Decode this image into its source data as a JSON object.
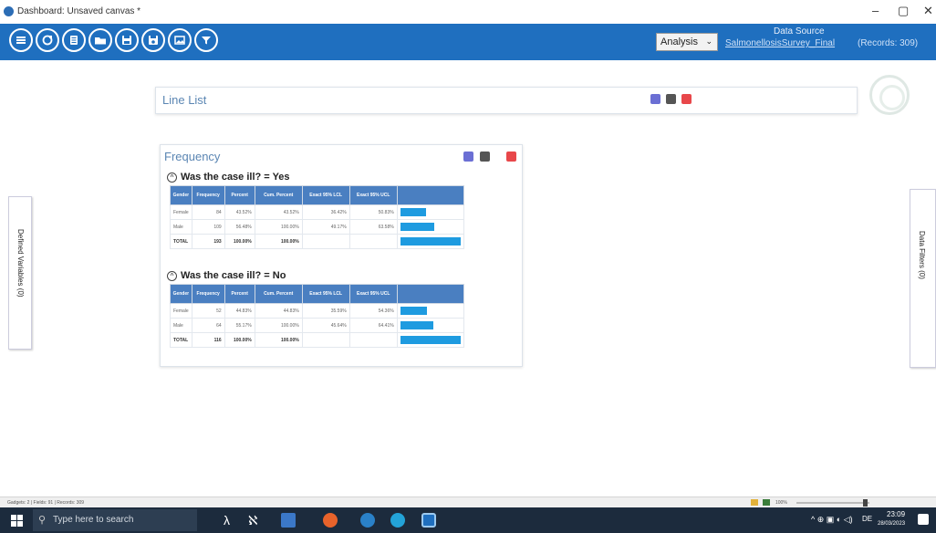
{
  "window": {
    "title": "Dashboard: Unsaved canvas *",
    "minimize": "–",
    "maximize": "▢",
    "close": "✕"
  },
  "toolbar": {
    "buttons": [
      "menu-icon",
      "refresh-icon",
      "list-icon",
      "folder-icon",
      "save-icon",
      "save-as-icon",
      "image-icon",
      "filter-icon"
    ],
    "analysis_label": "Analysis",
    "data_source_title": "Data Source",
    "data_source_name": "SalmonellosisSurvey_Final",
    "records": "(Records: 309)"
  },
  "side_tabs": {
    "left": "Defined Variables (0)",
    "right": "Data Filters (0)"
  },
  "line_list": {
    "title": "Line List"
  },
  "frequency": {
    "title": "Frequency",
    "columns": [
      "Gender",
      "Frequency",
      "Percent",
      "Cum. Percent",
      "Exact 95% LCL",
      "Exact 95% UCL",
      ""
    ],
    "tables": [
      {
        "heading": "Was the case ill? = Yes",
        "rows": [
          {
            "gender": "Female",
            "frequency": "84",
            "percent": "43.52%",
            "cum": "43.52%",
            "lcl": "36.42%",
            "ucl": "50.83%",
            "share": 0.4352
          },
          {
            "gender": "Male",
            "frequency": "109",
            "percent": "56.48%",
            "cum": "100.00%",
            "lcl": "49.17%",
            "ucl": "63.58%",
            "share": 0.5648
          }
        ],
        "total": {
          "label": "TOTAL",
          "frequency": "193",
          "percent": "100.00%",
          "cum": "100.00%"
        }
      },
      {
        "heading": "Was the case ill? = No",
        "rows": [
          {
            "gender": "Female",
            "frequency": "52",
            "percent": "44.83%",
            "cum": "44.83%",
            "lcl": "35.59%",
            "ucl": "54.36%",
            "share": 0.4483
          },
          {
            "gender": "Male",
            "frequency": "64",
            "percent": "55.17%",
            "cum": "100.00%",
            "lcl": "45.64%",
            "ucl": "64.41%",
            "share": 0.5517
          }
        ],
        "total": {
          "label": "TOTAL",
          "frequency": "116",
          "percent": "100.00%",
          "cum": "100.00%"
        }
      }
    ]
  },
  "status_bar": {
    "text": "Gadgets: 2 | Fields: 91 | Records: 309",
    "zoom": "100%"
  },
  "taskbar": {
    "search_placeholder": "Type here to search",
    "time": "23:09",
    "date": "28/03/2023",
    "lang": "DE"
  },
  "colors": {
    "toolbar": "#1f6fbf",
    "table_header": "#4a7fc1",
    "bar": "#1e9be0",
    "taskbar": "#1c2b3d"
  }
}
